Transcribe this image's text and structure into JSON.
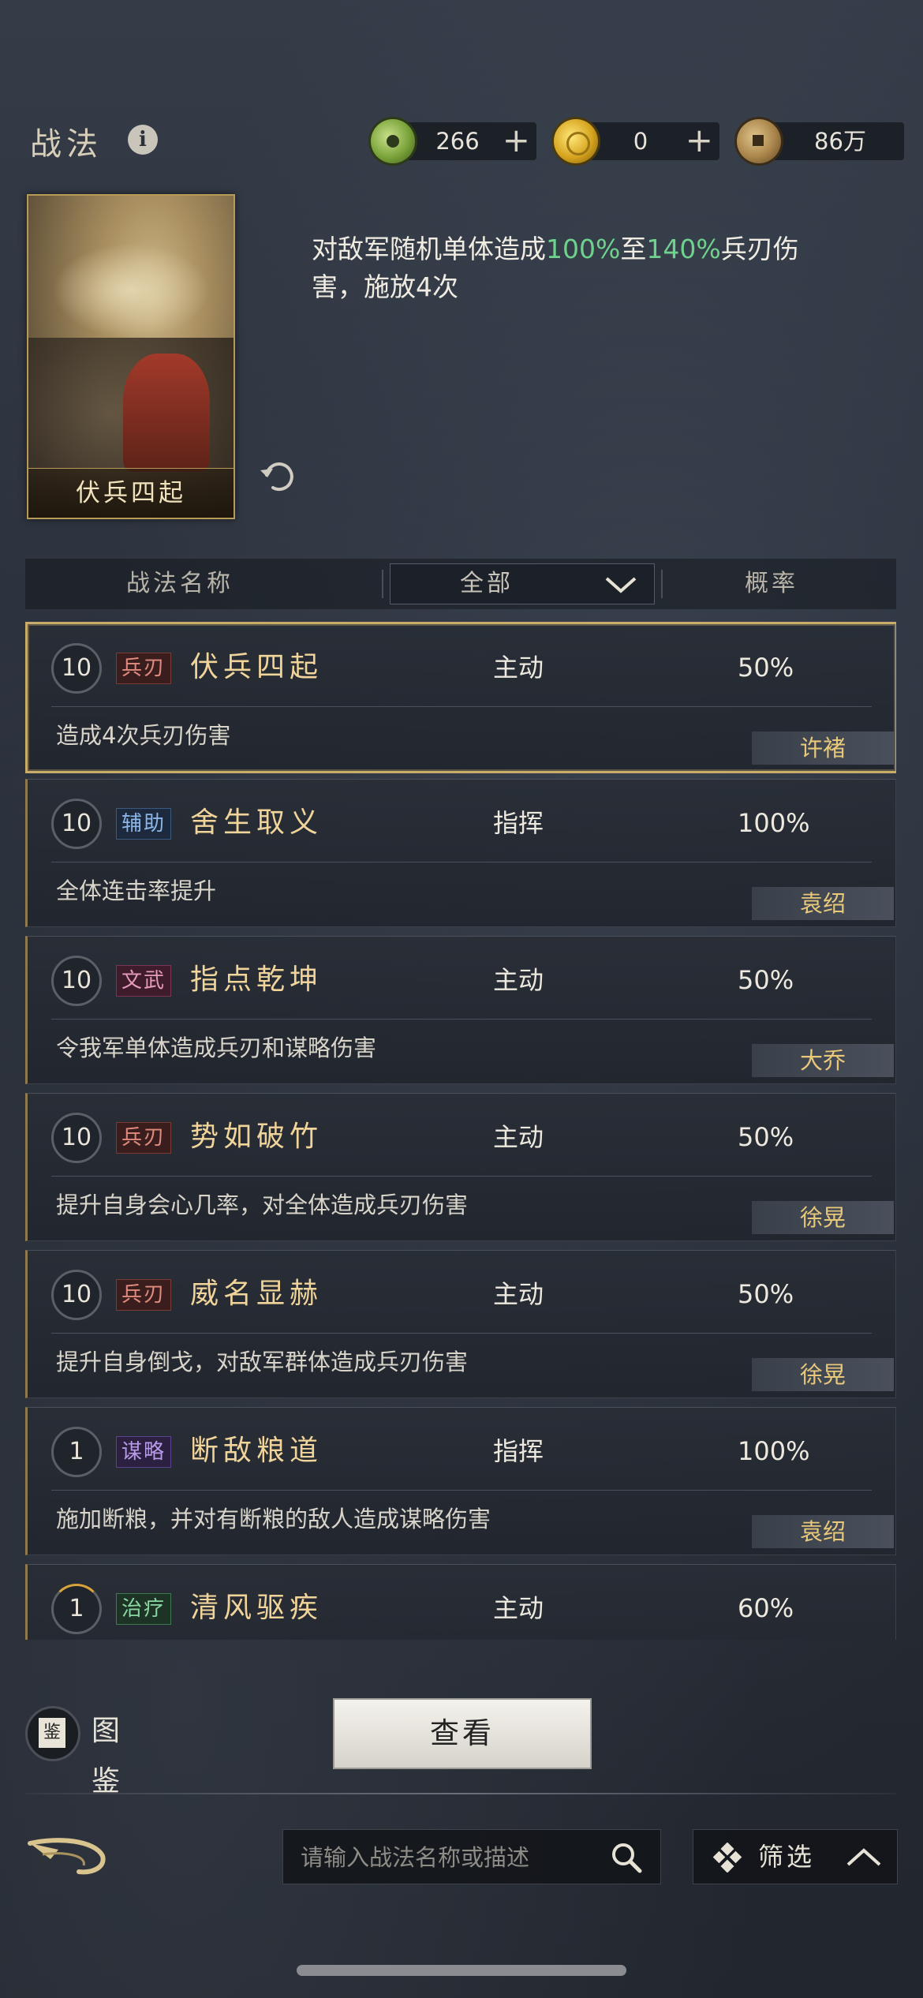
{
  "header": {
    "title": "战法",
    "info_symbol": "i",
    "resources": [
      {
        "icon": "jade-coin-icon",
        "value": "266",
        "has_plus": true,
        "plus": "+"
      },
      {
        "icon": "gold-coin-icon",
        "value": "0",
        "has_plus": true,
        "plus": "+"
      },
      {
        "icon": "copper-coin-icon",
        "value": "86万",
        "has_plus": false
      }
    ]
  },
  "selected_skill": {
    "card_name": "伏兵四起",
    "description_parts": [
      {
        "text": "对敌军随机单体造成",
        "highlight": false
      },
      {
        "text": "100%",
        "highlight": true
      },
      {
        "text": "至",
        "highlight": false
      },
      {
        "text": "140%",
        "highlight": true
      },
      {
        "text": "兵刃伤害，施放4次",
        "highlight": false
      }
    ]
  },
  "table_header": {
    "name_col": "战法名称",
    "filter_value": "全部",
    "prob_col": "概率"
  },
  "skills": [
    {
      "level": "10",
      "tag": "兵刃",
      "tag_type": "blade",
      "name": "伏兵四起",
      "type": "主动",
      "prob": "50%",
      "desc": "造成4次兵刃伤害",
      "hero": "许褚",
      "selected": true,
      "level_progress": 1
    },
    {
      "level": "10",
      "tag": "辅助",
      "tag_type": "assist",
      "name": "舍生取义",
      "type": "指挥",
      "prob": "100%",
      "desc": "全体连击率提升",
      "hero": "袁绍",
      "selected": false,
      "level_progress": 1
    },
    {
      "level": "10",
      "tag": "文武",
      "tag_type": "wenwu",
      "name": "指点乾坤",
      "type": "主动",
      "prob": "50%",
      "desc": "令我军单体造成兵刃和谋略伤害",
      "hero": "大乔",
      "selected": false,
      "level_progress": 1
    },
    {
      "level": "10",
      "tag": "兵刃",
      "tag_type": "blade",
      "name": "势如破竹",
      "type": "主动",
      "prob": "50%",
      "desc": "提升自身会心几率，对全体造成兵刃伤害",
      "hero": "徐晃",
      "selected": false,
      "level_progress": 1
    },
    {
      "level": "10",
      "tag": "兵刃",
      "tag_type": "blade",
      "name": "威名显赫",
      "type": "主动",
      "prob": "50%",
      "desc": "提升自身倒戈，对敌军群体造成兵刃伤害",
      "hero": "徐晃",
      "selected": false,
      "level_progress": 1
    },
    {
      "level": "1",
      "tag": "谋略",
      "tag_type": "strat",
      "name": "断敌粮道",
      "type": "指挥",
      "prob": "100%",
      "desc": "施加断粮，并对有断粮的敌人造成谋略伤害",
      "hero": "袁绍",
      "selected": false,
      "level_progress": 0
    },
    {
      "level": "1",
      "tag": "治疗",
      "tag_type": "heal",
      "name": "清风驱疾",
      "type": "主动",
      "prob": "60%",
      "desc": "",
      "hero": "",
      "selected": false,
      "level_progress": 0.15
    }
  ],
  "footer": {
    "tujian_icon_char": "鉴",
    "tujian_label": "图鉴",
    "view_button": "查看",
    "search_placeholder": "请输入战法名称或描述",
    "filter_button": "筛选"
  },
  "colors": {
    "highlight_green": "#6fd28c",
    "gold_text": "#f0d49a",
    "hero_badge_text": "#e9c879",
    "selected_border": "#c8ad6a"
  }
}
